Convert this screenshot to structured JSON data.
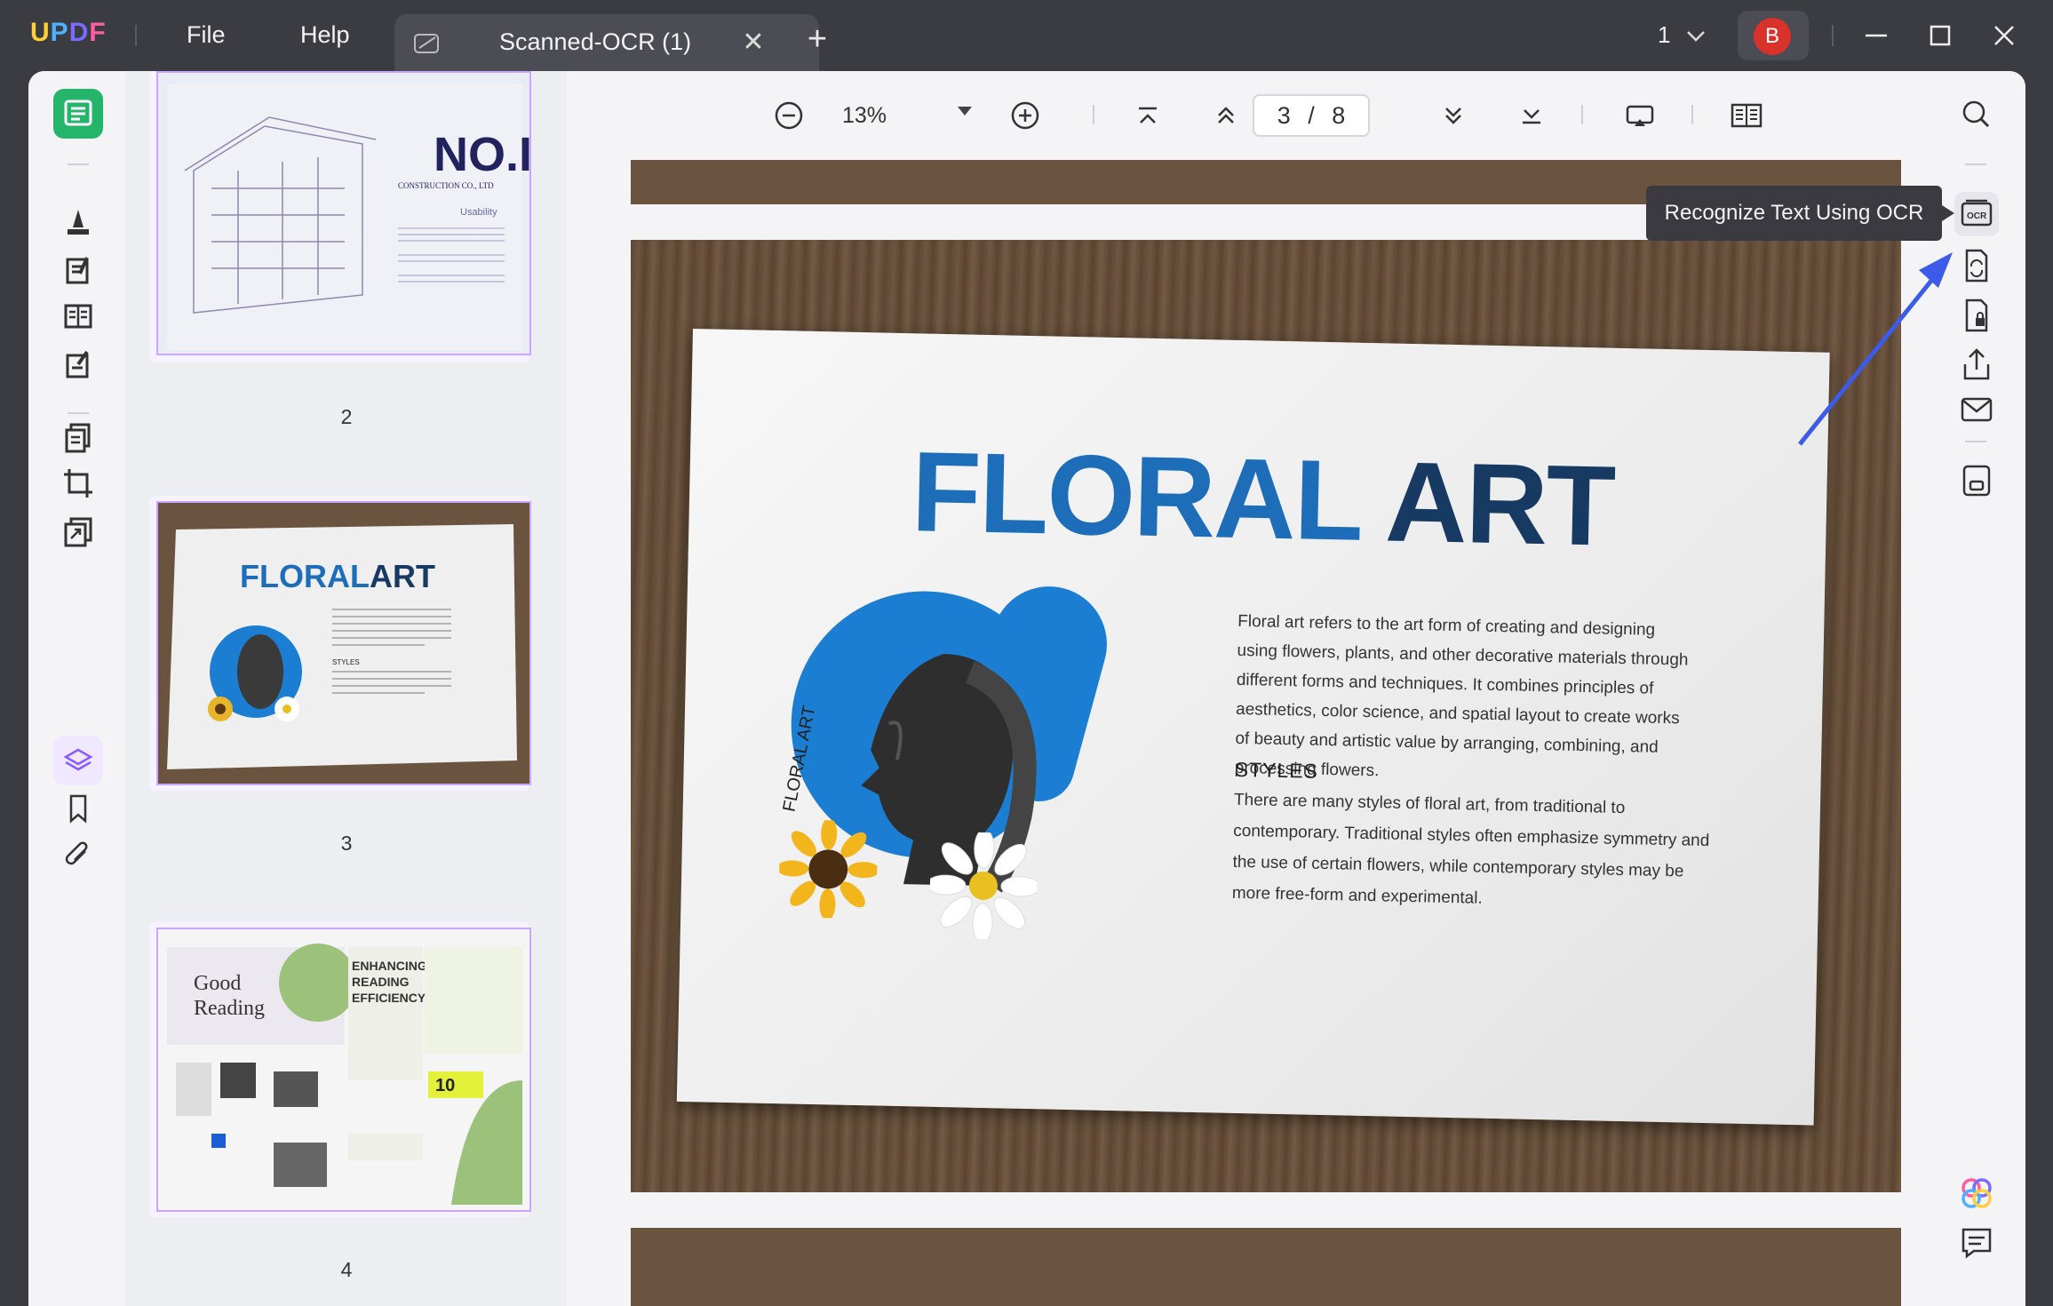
{
  "app": {
    "logo": "UPDF",
    "menu": [
      "File",
      "Help"
    ],
    "tab_title": "Scanned-OCR (1)",
    "window_count": "1",
    "avatar_letter": "B"
  },
  "toolbar": {
    "zoom": "13%",
    "current_page": "3",
    "total_pages": "8",
    "page_sep": "/"
  },
  "thumbnails": [
    {
      "label": "2",
      "title": "NO.I",
      "subtitle": "CONSTRUCTION CO., LTD",
      "heading": "Usability"
    },
    {
      "label": "3",
      "title_floral": "FLORAL",
      "title_art": "ART"
    },
    {
      "label": "4",
      "title": "Good Reading",
      "heading": "ENHANCING READING EFFICIENCY"
    }
  ],
  "document": {
    "title_floral": "FLORAL",
    "title_art": "ART",
    "paragraph": "Floral art refers to the art form of creating and designing using flowers, plants, and other decorative materials through different forms and techniques.  It combines principles of aesthetics, color science, and spatial layout to create works of beauty and artistic value by arranging, combining, and processing flowers.",
    "styles_heading": "STYLES",
    "styles_text": "There are many styles of floral art, from traditional to contemporary. Traditional styles often emphasize symmetry and the use of certain flowers, while contemporary styles may be more free-form and experimental.",
    "curved_text": "FLORAL ART"
  },
  "tooltip": {
    "text": "Recognize Text Using OCR"
  },
  "icons": {
    "left_rail": [
      "reader-icon",
      "comment-icon",
      "edit-icon",
      "form-icon",
      "sign-icon",
      "organize-icon",
      "crop-icon",
      "convert-icon",
      "layers-icon",
      "bookmark-icon",
      "attachment-icon"
    ],
    "right_rail": [
      "search-icon",
      "ocr-icon",
      "convert-file-icon",
      "protect-icon",
      "share-icon",
      "email-icon",
      "save-icon",
      "ai-assistant-icon",
      "chat-icon"
    ]
  },
  "colors": {
    "accent": "#7a5cff",
    "floral_blue": "#1d6db8",
    "art_navy": "#163a62",
    "avatar": "#d9322b",
    "arrow": "#3b5be8"
  }
}
